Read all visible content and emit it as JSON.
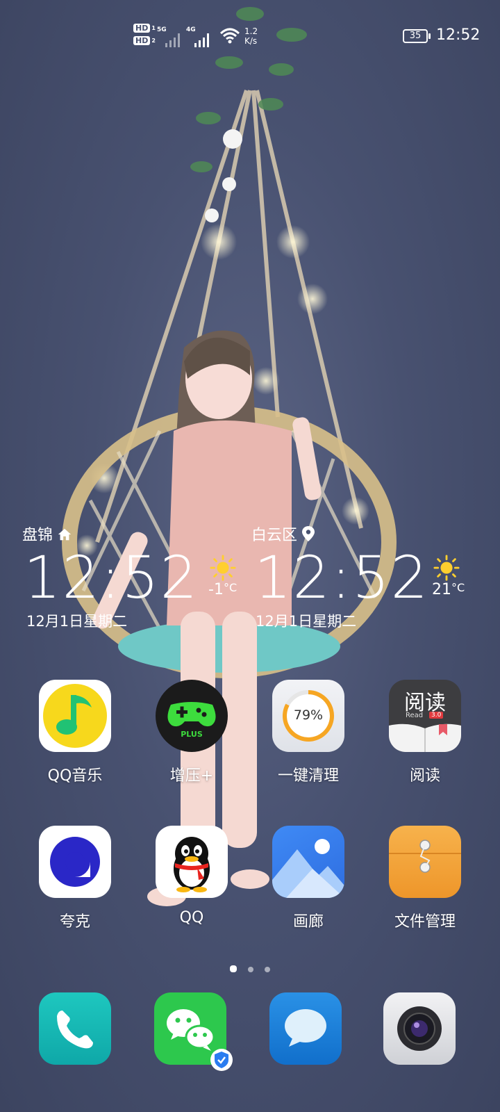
{
  "status_bar": {
    "hd1": "HD",
    "hd1_sub": "1",
    "hd2": "HD",
    "hd2_sub": "2",
    "sim1_network": "5G",
    "sim2_network": "4G",
    "speed_value": "1.2",
    "speed_unit": "K/s",
    "battery": "35",
    "time": "12:52"
  },
  "widgets": {
    "home": {
      "city": "盘锦",
      "time": "12:52",
      "date": "12月1日星期二",
      "temp": "-1",
      "unit": "°C",
      "weather_icon": "sun-icon"
    },
    "current": {
      "city": "白云区",
      "time": "12:52",
      "date": "12月1日星期二",
      "temp": "21",
      "unit": "°C",
      "weather_icon": "sun-icon"
    }
  },
  "apps": [
    {
      "label": "QQ音乐",
      "icon": "qq-music-icon"
    },
    {
      "label": "增压+",
      "icon": "boost-plus-icon",
      "badge_text": "PLUS"
    },
    {
      "label": "一键清理",
      "icon": "cleaner-icon",
      "percent": "79%"
    },
    {
      "label": "阅读",
      "icon": "reader-icon",
      "icon_title": "阅读",
      "icon_sub": "Read",
      "icon_version": "3.0"
    },
    {
      "label": "夸克",
      "icon": "quark-icon"
    },
    {
      "label": "QQ",
      "icon": "qq-icon"
    },
    {
      "label": "画廊",
      "icon": "gallery-icon"
    },
    {
      "label": "文件管理",
      "icon": "files-icon"
    }
  ],
  "pager": {
    "count": 3,
    "active": 0
  },
  "dock": [
    {
      "icon": "phone-icon"
    },
    {
      "icon": "wechat-icon"
    },
    {
      "icon": "messages-icon"
    },
    {
      "icon": "camera-icon"
    }
  ],
  "colors": {
    "wallpaper": "#485170",
    "qq_music_yellow": "#f7d81c",
    "qq_music_green": "#21c274",
    "boost_green": "#3ddc3d",
    "gallery_blue": "#3f8af5",
    "files_orange": "#f5a43a",
    "phone_teal": "#12b8b3",
    "wechat_green": "#2dc84d",
    "messages_blue": "#1a7fd8",
    "quark_blue": "#2a27c7"
  }
}
